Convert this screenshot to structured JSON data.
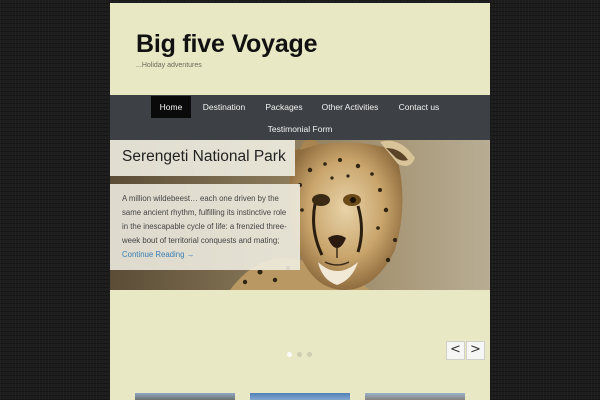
{
  "site": {
    "title": "Big five Voyage",
    "tagline": "...Holiday adventures"
  },
  "nav": {
    "items": [
      {
        "label": "Home",
        "active": true
      },
      {
        "label": "Destination"
      },
      {
        "label": "Packages"
      },
      {
        "label": "Other Activities"
      },
      {
        "label": "Contact us"
      },
      {
        "label": "Testimonial Form"
      }
    ]
  },
  "slider": {
    "title": "Serengeti National Park",
    "caption": "A million wildebeest… each one driven by the same ancient rhythm, fulfilling its instinctive role in the inescapable cycle of life: a frenzied three-week bout of territorial conquests and mating; ",
    "link_label": "Continue Reading →",
    "prev_label": "<",
    "next_label": ">",
    "dots": 3,
    "active_dot": 1,
    "image": "cheetah-photo"
  },
  "colors": {
    "background": "#1c1c1c",
    "page": "#e9e8c5",
    "nav": "#3d4044",
    "nav_active": "#0a0a0a",
    "link": "#3a7fb5"
  }
}
